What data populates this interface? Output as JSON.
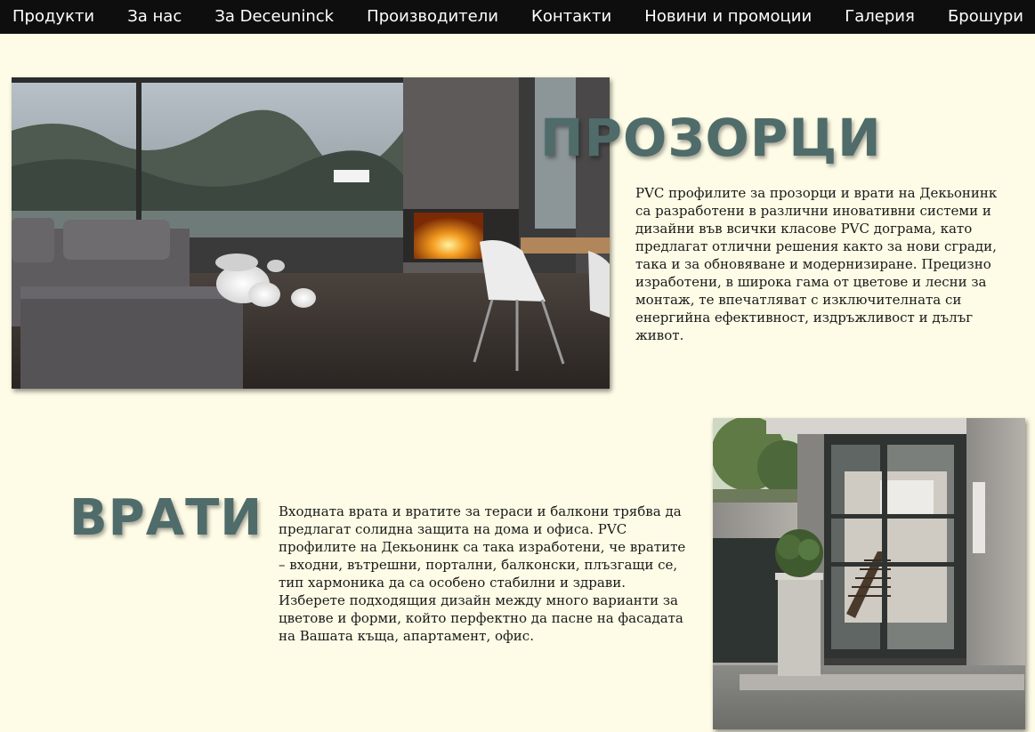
{
  "nav": {
    "items": [
      "Продукти",
      "За нас",
      "За Deceuninck",
      "Производители",
      "Контакти",
      "Новини и промоции",
      "Галерия",
      "Брошури"
    ]
  },
  "windows": {
    "title": "ПРОЗОРЦИ",
    "text": "PVC профилите за прозорци и врати на Декьонинк са разработени в различни иновативни системи и дизайни във всички класове PVC дограма, като предлагат отлични решения както за нови сгради, така и за обновяване и модернизиране. Прецизно изработени, в широка гама от цветове и лесни за монтаж, те впечатляват с изключителната си енергийна ефективност, издръжливост и дълъг живот."
  },
  "doors": {
    "title": "ВРАТИ",
    "text": "Входната врата и вратите за тераси и балкони трябва да предлагат солидна защита на дома и офиса. PVC профилите на Декьонинк са така изработени, че вратите – входни, вътрешни, портални, балконски, плъзгащи се, тип хармоника да са особено стабилни и здрави. Изберете подходящия дизайн между много варианти за цветове и форми, който перфектно да пасне на фасадата на Вашата къща, апартамент, офис."
  },
  "colors": {
    "background": "#fefce6",
    "nav_background": "#0e0e0e",
    "heading": "#4f6b6a"
  }
}
